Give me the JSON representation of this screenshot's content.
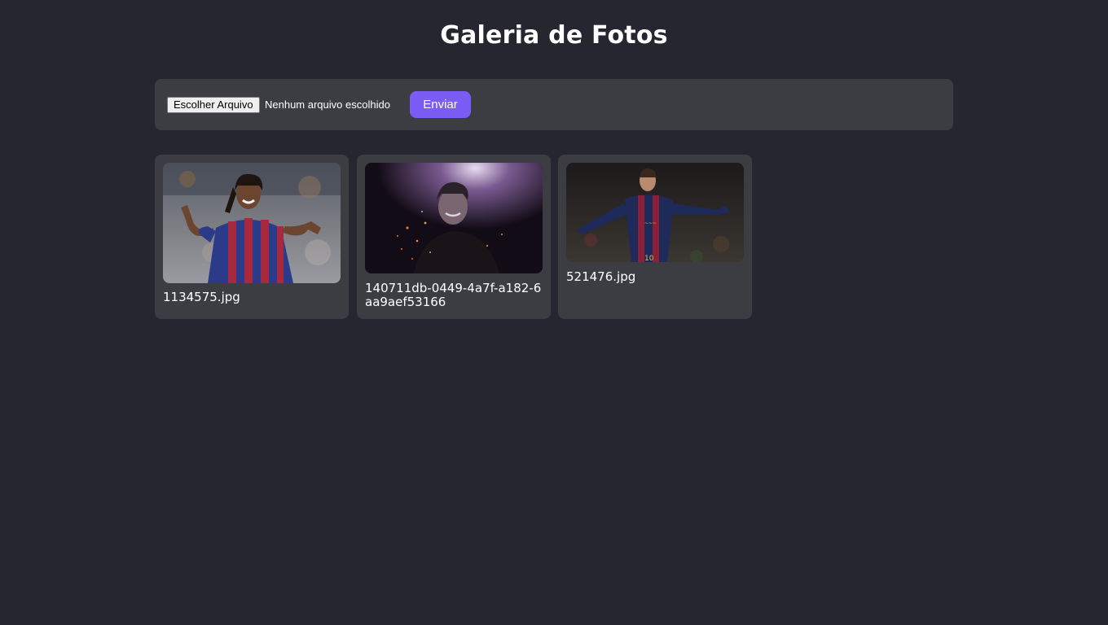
{
  "page": {
    "title": "Galeria de Fotos"
  },
  "upload": {
    "file_button_label": "Escolher Arquivo",
    "file_status": "Nenhum arquivo escolhido",
    "submit_label": "Enviar",
    "accent_color": "#7b5cf5"
  },
  "gallery": {
    "items": [
      {
        "caption": "1134575.jpg",
        "image": "photo-player-celebrating"
      },
      {
        "caption": "140711db-0449-4a7f-a182-6aa9aef53166",
        "image": "photo-player-dark-portrait"
      },
      {
        "caption": "521476.jpg",
        "image": "photo-player-arms-open"
      }
    ]
  }
}
